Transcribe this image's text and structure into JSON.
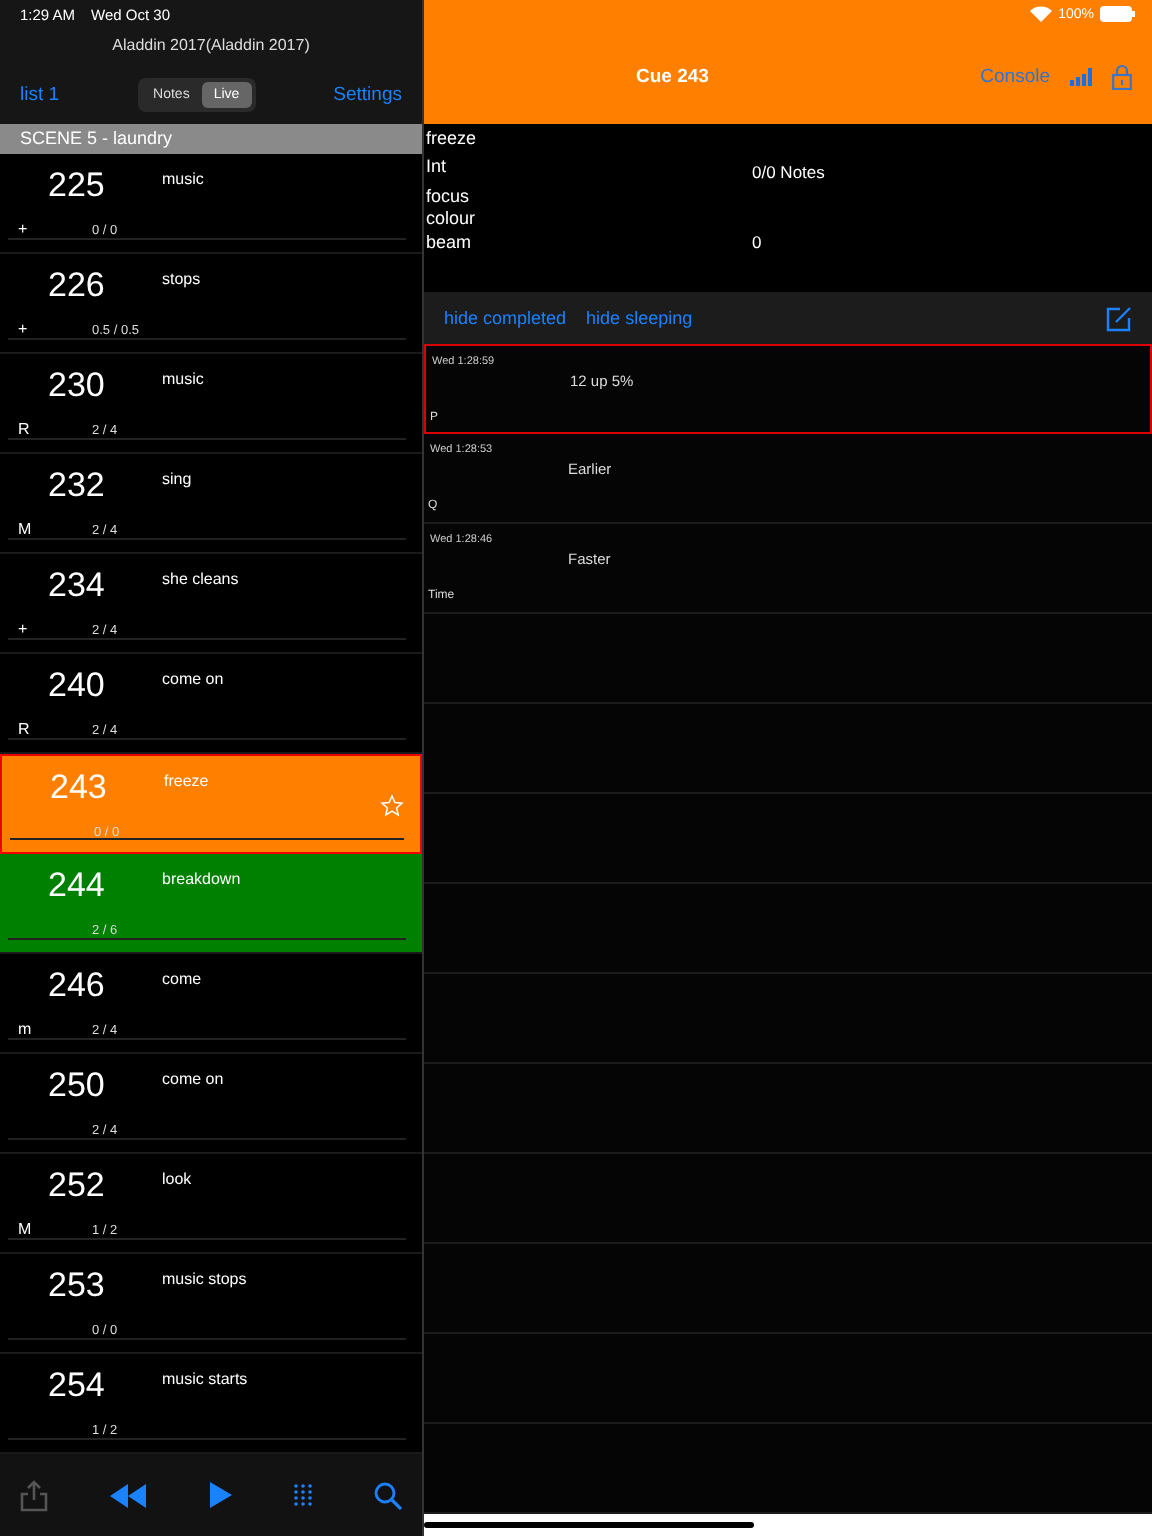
{
  "status_bar": {
    "time": "1:29 AM",
    "date": "Wed Oct 30",
    "battery": "100%"
  },
  "left": {
    "title": "Aladdin 2017(Aladdin 2017)",
    "list_button": "list 1",
    "segments": [
      {
        "label": "Notes",
        "selected": false
      },
      {
        "label": "Live",
        "selected": true
      }
    ],
    "settings_button": "Settings",
    "scene": "SCENE 5 - laundry",
    "cues": [
      {
        "number": "225",
        "title": "music",
        "mark": "+",
        "count": "0 / 0",
        "selected": false
      },
      {
        "number": "226",
        "title": "stops",
        "mark": "+",
        "count": "0.5 / 0.5",
        "selected": false
      },
      {
        "number": "230",
        "title": "music",
        "mark": "R",
        "count": "2 / 4",
        "selected": false
      },
      {
        "number": "232",
        "title": "sing",
        "mark": "M",
        "count": "2 / 4",
        "selected": false
      },
      {
        "number": "234",
        "title": "she cleans",
        "mark": "+",
        "count": "2 / 4",
        "selected": false
      },
      {
        "number": "240",
        "title": "come on",
        "mark": "R",
        "count": "2 / 4",
        "selected": false
      },
      {
        "number": "243",
        "title": "freeze",
        "count": "0 / 0",
        "selected": true
      },
      {
        "number": "244",
        "title": "breakdown",
        "count": "2 / 6",
        "selected": false,
        "color": "#008000"
      },
      {
        "number": "246",
        "title": "come",
        "mark": "m",
        "count": "2 / 4",
        "selected": false
      },
      {
        "number": "250",
        "title": "come on",
        "count": "2 / 4",
        "selected": false
      },
      {
        "number": "252",
        "title": "look",
        "mark": "M",
        "count": "1 / 2",
        "selected": false
      },
      {
        "number": "253",
        "title": "music stops",
        "count": "0 / 0",
        "selected": false
      },
      {
        "number": "254",
        "title": "music starts",
        "count": "1 / 2",
        "selected": false
      }
    ]
  },
  "right": {
    "title": "Cue 243",
    "console_button": "Console",
    "cue_name": "freeze",
    "fields": [
      {
        "label": "Int",
        "value": "0/0  Notes"
      },
      {
        "label": "focus"
      },
      {
        "label": "colour"
      },
      {
        "label": "beam",
        "value": "0"
      }
    ],
    "filters": [
      "hide completed",
      "hide sleeping"
    ],
    "notes": [
      {
        "time": "Wed 1:28:59",
        "text": "12 up 5%",
        "tag": "P",
        "selected": true
      },
      {
        "time": "Wed 1:28:53",
        "text": "Earlier",
        "tag": "Q",
        "selected": false
      },
      {
        "time": "Wed 1:28:46",
        "text": "Faster",
        "tag": "Time",
        "selected": false
      }
    ]
  }
}
